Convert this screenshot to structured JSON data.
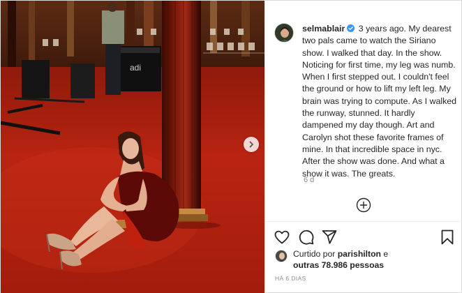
{
  "post": {
    "username": "selmablair",
    "verified": true,
    "caption": "3 years ago. My dearest two pals came to watch the Siriano show. I walked that day. In the show. Noticing for first time, my leg was numb. When I first stepped out. I couldn't feel the ground or how to lift my left leg. My brain was trying to compute. As I walked the runway, stunned. It hardly dampened my day though. Art and Carolyn shot these favorite frames of mine. In that incredible space in nyc. After the show was done. And what a show it was. The greats.",
    "comment_time": "6 d",
    "likes_prefix": "Curtido por",
    "likes_user": "parishilton",
    "likes_connector": "e",
    "likes_others": "outras 78.986 pessoas",
    "date": "HÁ 6 DIAS"
  },
  "photo": {
    "sign_text": "adi"
  },
  "icons": {
    "next": "chevron-right-icon",
    "add_comment": "plus-circle-icon",
    "like": "heart-icon",
    "comment": "speech-bubble-icon",
    "share": "paper-plane-icon",
    "save": "bookmark-icon",
    "verified": "verified-badge-icon"
  },
  "colors": {
    "verified_blue": "#3897f0",
    "carpet_red": "#b5210e",
    "text": "#262626",
    "muted": "#8e8e8e"
  }
}
